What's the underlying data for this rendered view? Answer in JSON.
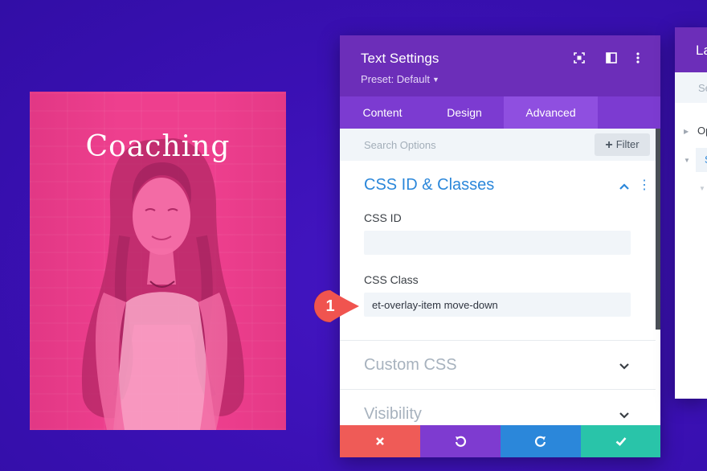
{
  "card": {
    "title": "Coaching",
    "overlay_color": "#ee3f8e"
  },
  "panel": {
    "title": "Text Settings",
    "preset_label": "Preset: Default",
    "header_icons": [
      "fullscreen-icon",
      "split-view-icon",
      "more-icon"
    ],
    "tabs": [
      {
        "label": "Content",
        "active": false
      },
      {
        "label": "Design",
        "active": false
      },
      {
        "label": "Advanced",
        "active": true
      }
    ],
    "search_placeholder": "Search Options",
    "filter_label": "Filter",
    "sections": {
      "css": {
        "title": "CSS ID & Classes",
        "expanded": true,
        "css_id_label": "CSS ID",
        "css_id_value": "",
        "css_class_label": "CSS Class",
        "css_class_value": "et-overlay-item move-down"
      },
      "custom_css": {
        "title": "Custom CSS",
        "expanded": false
      },
      "visibility": {
        "title": "Visibility",
        "expanded": false
      }
    },
    "footer": [
      {
        "name": "cancel",
        "icon": "close-icon",
        "color": "#ef5b57"
      },
      {
        "name": "undo",
        "icon": "undo-icon",
        "color": "#7e3bd0"
      },
      {
        "name": "redo",
        "icon": "redo-icon",
        "color": "#2b87da"
      },
      {
        "name": "save",
        "icon": "check-icon",
        "color": "#29c4a9"
      }
    ]
  },
  "layers_panel": {
    "title": "La",
    "search_placeholder": "Se",
    "tree": [
      {
        "text": "Op"
      },
      {
        "text": "S"
      }
    ]
  },
  "callout": {
    "number": "1",
    "color": "#f0544f"
  },
  "colors": {
    "background": "#3b12b8",
    "panel_header": "#6c2eb9",
    "tabs_bar": "#7c3bd1",
    "accent_blue": "#2b87da"
  }
}
